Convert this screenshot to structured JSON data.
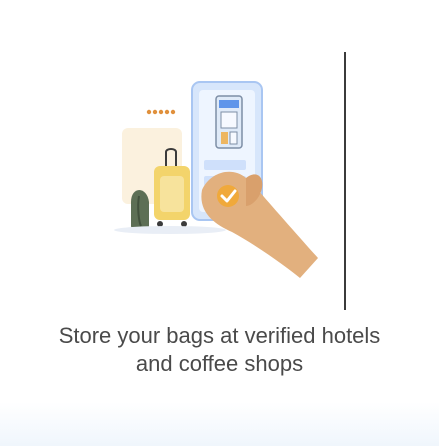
{
  "onboarding": {
    "headline_line1": "Store your bags at verified hotels",
    "headline_line2": "and coffee shops"
  },
  "illustration": {
    "rating_stars": 5,
    "icons": [
      "star-rating-icon",
      "storefront-icon",
      "phone-icon",
      "suitcase-icon",
      "backpack-icon",
      "checkmark-badge-icon",
      "hand-icon"
    ]
  },
  "colors": {
    "caption_text": "#4a4a4a",
    "phone_frame": "#d7e6fb",
    "phone_screen": "#eef5ff",
    "accent_blue": "#3f7fe6",
    "skin": "#e2b07e",
    "suitcase": "#f3d46b",
    "checkmark_badge": "#f0a93b",
    "stars": "#e0903c"
  }
}
